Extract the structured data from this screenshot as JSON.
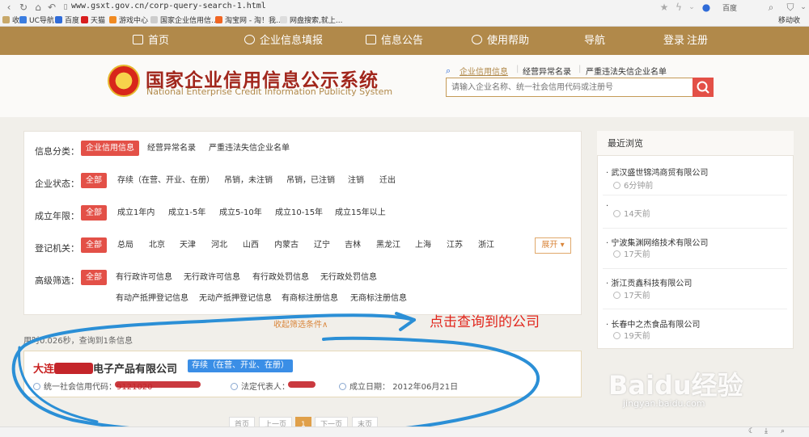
{
  "browser": {
    "url": "www.gsxt.gov.cn/corp-query-search-1.html",
    "search_engine": "百度",
    "bookmarks": [
      "收藏",
      "UC导航",
      "百度",
      "天猫",
      "游戏中心",
      "国家企业信用信...",
      "淘宝网 - 淘！我...",
      "网盘搜索,就上...",
      "移动收"
    ]
  },
  "nav": {
    "items": [
      "首页",
      "企业信息填报",
      "信息公告",
      "使用帮助",
      "导航",
      "登录",
      "注册"
    ]
  },
  "header": {
    "title_cn": "国家企业信用信息公示系统",
    "title_en": "National Enterprise Credit Information Publicity System",
    "query_tabs": [
      "企业信用信息",
      "经营异常名录",
      "严重违法失信企业名单"
    ],
    "search_placeholder": "请输入企业名称、统一社会信用代码或注册号"
  },
  "filters": {
    "info_type": {
      "label": "信息分类：",
      "options": [
        "企业信用信息",
        "经营异常名录",
        "严重违法失信企业名单"
      ]
    },
    "status": {
      "label": "企业状态：",
      "options": [
        "全部",
        "存续（在营、开业、在册）",
        "吊销，未注销",
        "吊销，已注销",
        "注销",
        "迁出"
      ]
    },
    "years": {
      "label": "成立年限：",
      "options": [
        "全部",
        "成立1年内",
        "成立1-5年",
        "成立5-10年",
        "成立10-15年",
        "成立15年以上"
      ]
    },
    "authority": {
      "label": "登记机关：",
      "options": [
        "全部",
        "总局",
        "北京",
        "天津",
        "河北",
        "山西",
        "内蒙古",
        "辽宁",
        "吉林",
        "黑龙江",
        "上海",
        "江苏",
        "浙江"
      ],
      "expand": "展开"
    },
    "advanced": {
      "label": "高级筛选：",
      "row1": [
        "全部",
        "有行政许可信息",
        "无行政许可信息",
        "有行政处罚信息",
        "无行政处罚信息"
      ],
      "row2": [
        "有动产抵押登记信息",
        "无动产抵押登记信息",
        "有商标注册信息",
        "无商标注册信息"
      ]
    },
    "collapse": "收起筛选条件∧"
  },
  "results": {
    "stats": "用时0.026秒，查询到1条信息",
    "company_prefix": "大连",
    "company_suffix": "电子产品有限公司",
    "status": "存续（在营、开业、在册）",
    "credit_code_label": "统一社会信用代码：",
    "credit_code_partial": "9121020",
    "legal_rep_label": "法定代表人：",
    "date_label": "成立日期：",
    "date_value": "2012年06月21日"
  },
  "pagination": [
    "首页",
    "上一页",
    "1",
    "下一页",
    "末页"
  ],
  "recent": {
    "title": "最近浏览",
    "items": [
      {
        "name": "武汉盛世锦鸿商贸有限公司",
        "time": "6分钟前"
      },
      {
        "name": "",
        "time": "14天前"
      },
      {
        "name": "宁波集渊网络技术有限公司",
        "time": "17天前"
      },
      {
        "name": "浙江贡鑫科技有限公司",
        "time": "17天前"
      },
      {
        "name": "长春中之杰食品有限公司",
        "time": "19天前"
      }
    ]
  },
  "annotation": "点击查询到的公司",
  "watermark": {
    "brand": "Baidu经验",
    "site": "jingyan.baidu.com"
  },
  "colors": {
    "nav": "#b1894a",
    "accent": "#e35047",
    "title": "#a1261c",
    "annotation": "#e1251b",
    "scribble": "#2b8fd6"
  }
}
